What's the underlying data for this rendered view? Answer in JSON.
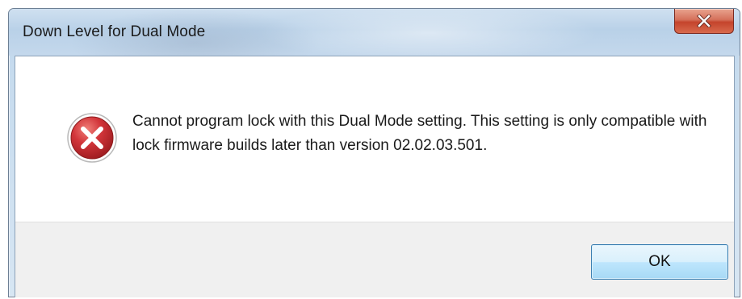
{
  "window": {
    "title": "Down Level for Dual Mode"
  },
  "dialog": {
    "icon": "error-icon",
    "message": "Cannot program lock with this Dual Mode setting. This setting is only compatible with lock firmware builds later than version 02.02.03.501.",
    "ok_label": "OK"
  },
  "colors": {
    "close_button": "#c4442c",
    "error_icon": "#c1272d",
    "ok_button_border": "#3c7fb1",
    "footer_bg": "#f0f0f0"
  }
}
